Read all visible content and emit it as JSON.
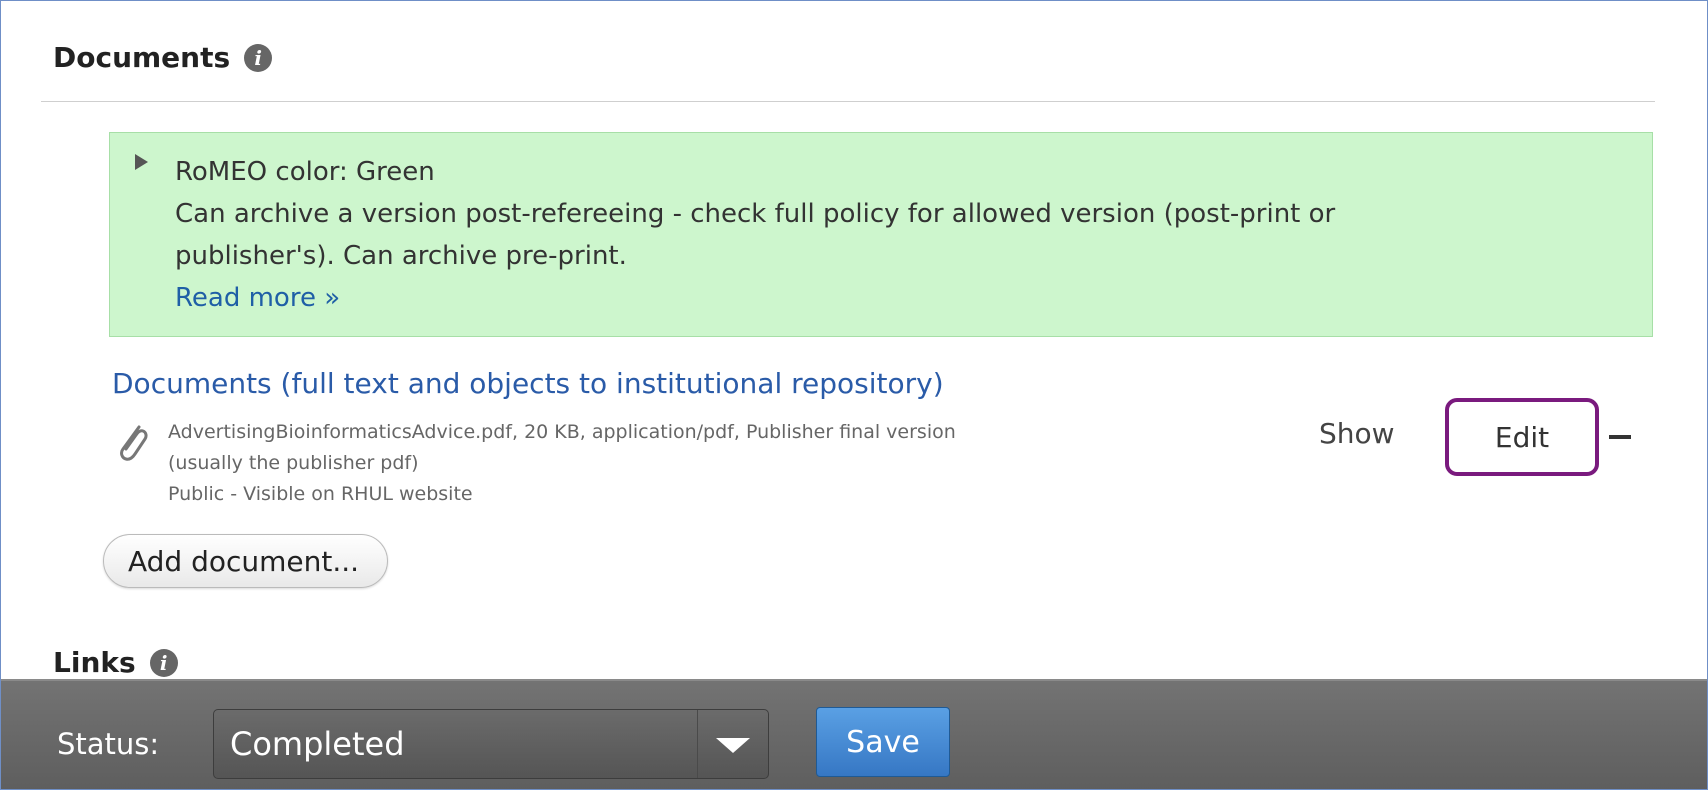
{
  "documents_section": {
    "title": "Documents",
    "info_icon": "info-icon"
  },
  "romeo": {
    "color_line": "RoMEO color: Green",
    "description_line1": "Can archive a version post-refereeing - check full policy for allowed version (post-print or",
    "description_line2": "publisher's). Can archive pre-print.",
    "read_more": "Read more »",
    "background_color": "#cdf6cd"
  },
  "document_group": {
    "link_text": "Documents (full text and objects to institutional repository)",
    "file": {
      "icon": "paperclip-icon",
      "line1": "AdvertisingBioinformaticsAdvice.pdf, 20 KB, application/pdf, Publisher final version",
      "line2": "(usually the publisher pdf)",
      "line3": "Public - Visible on RHUL website"
    },
    "actions": {
      "show": "Show",
      "edit": "Edit",
      "remove_icon": "minus-icon"
    },
    "add_button": "Add document..."
  },
  "links_section": {
    "title": "Links",
    "info_icon": "info-icon"
  },
  "status_bar": {
    "label": "Status:",
    "selected": "Completed",
    "save_label": "Save",
    "save_color": "#3f86d6",
    "highlight_color": "#7a1a7e"
  }
}
